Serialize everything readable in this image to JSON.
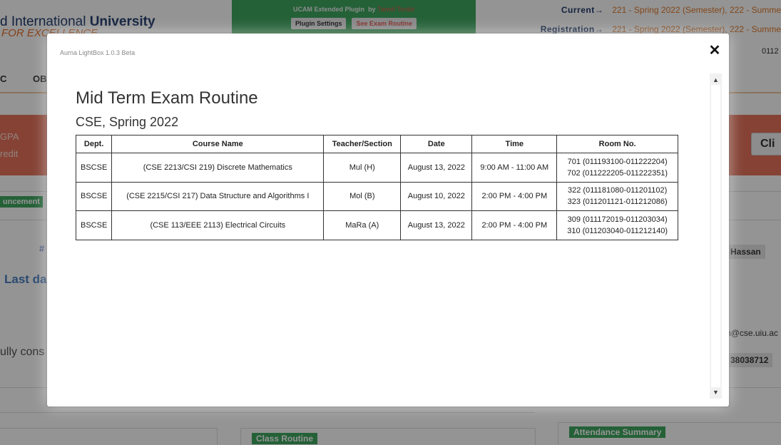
{
  "background": {
    "university_name_prefix": "d International ",
    "university_name_bold": "University",
    "university_tagline": "FOR EXCELLENCE",
    "plugin": {
      "title": "UCAM Extended Plugin",
      "by": "by",
      "author": "Tawsif Torabi",
      "settings_button": "Plugin Settings",
      "exam_routine_button": "See Exam Routine"
    },
    "current_label": "Current→",
    "current_value": "221 - Spring 2022 (Semester), 222 - Summe",
    "registration_label": "Registration→",
    "registration_value": "221 - Spring 2022 (Semester), 222 - Summe",
    "phone_top": "0112",
    "nav": [
      "C",
      "OB"
    ],
    "banner_line1": "GPA",
    "banner_line2": "redit",
    "banner_button": "Cli",
    "announcement_badge": "uncement",
    "hash_text": "#",
    "last_date_text": "Last da",
    "fully_text": "ully cons",
    "teacher_name": "r Hassan",
    "email_text": "n@cse.uiu.ac",
    "phone_text": "38038712",
    "class_routine_badge": "Class Routine",
    "attendance_badge": "Attendance Summary"
  },
  "lightbox": {
    "version": "Aurna LightBox 1.0.3 Beta",
    "close_glyph": "✕",
    "scroll_up": "▲",
    "scroll_down": "▼",
    "title": "Mid Term Exam Routine",
    "subtitle": "CSE, Spring 2022",
    "table": {
      "headers": [
        "Dept.",
        "Course Name",
        "Teacher/Section",
        "Date",
        "Time",
        "Room No."
      ],
      "rows": [
        {
          "dept": "BSCSE",
          "course": "(CSE 2213/CSI 219) Discrete Mathematics",
          "teacher": "Mul (H)",
          "date": "August 13, 2022",
          "time": "9:00 AM - 11:00 AM",
          "room1": "701 (011193100-011222204)",
          "room2": "702 (011222205-011222351)"
        },
        {
          "dept": "BSCSE",
          "course": "(CSE 2215/CSI 217) Data Structure and Algorithms I",
          "teacher": "Mol (B)",
          "date": "August 10, 2022",
          "time": "2:00 PM - 4:00 PM",
          "room1": "322 (011181080-011201102)",
          "room2": "323 (011201121-011212086)"
        },
        {
          "dept": "BSCSE",
          "course": "(CSE 113/EEE 2113) Electrical Circuits",
          "teacher": "MaRa (A)",
          "date": "August 13, 2022",
          "time": "2:00 PM - 4:00 PM",
          "room1": "309 (011172019-011203034)",
          "room2": "310 (011203040-011212140)"
        }
      ]
    }
  }
}
